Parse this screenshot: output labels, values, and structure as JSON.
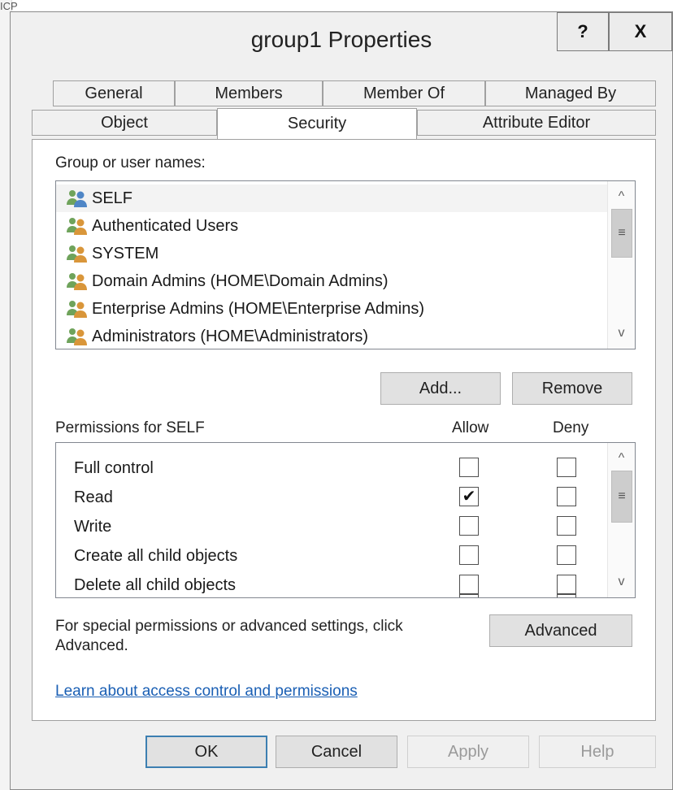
{
  "background": {
    "fragment_text": "ICP"
  },
  "window": {
    "title": "group1 Properties",
    "help_glyph": "?",
    "close_glyph": "X"
  },
  "tabs": {
    "row1": [
      "General",
      "Members",
      "Member Of",
      "Managed By"
    ],
    "row2": [
      "Object",
      "Security",
      "Attribute Editor"
    ],
    "active": "Security"
  },
  "principals": {
    "label": "Group or user names:",
    "items": [
      "SELF",
      "Authenticated Users",
      "SYSTEM",
      "Domain Admins (HOME\\Domain Admins)",
      "Enterprise Admins (HOME\\Enterprise Admins)",
      "Administrators (HOME\\Administrators)"
    ],
    "selected": "SELF",
    "add_label": "Add...",
    "remove_label": "Remove"
  },
  "permissions": {
    "label": "Permissions for SELF",
    "allow_header": "Allow",
    "deny_header": "Deny",
    "rows": [
      {
        "name": "Full control",
        "allow": false,
        "deny": false
      },
      {
        "name": "Read",
        "allow": true,
        "deny": false
      },
      {
        "name": "Write",
        "allow": false,
        "deny": false
      },
      {
        "name": "Create all child objects",
        "allow": false,
        "deny": false
      },
      {
        "name": "Delete all child objects",
        "allow": false,
        "deny": false
      }
    ],
    "check_glyph": "✔"
  },
  "advanced": {
    "text_line1": "For special permissions or advanced settings, click",
    "text_line2": "Advanced.",
    "button_label": "Advanced"
  },
  "help_link": "Learn about access control and permissions",
  "footer": {
    "ok": "OK",
    "cancel": "Cancel",
    "apply": "Apply",
    "help": "Help"
  },
  "scroll_glyphs": {
    "up": "^",
    "down": "v",
    "grip": "≡"
  }
}
